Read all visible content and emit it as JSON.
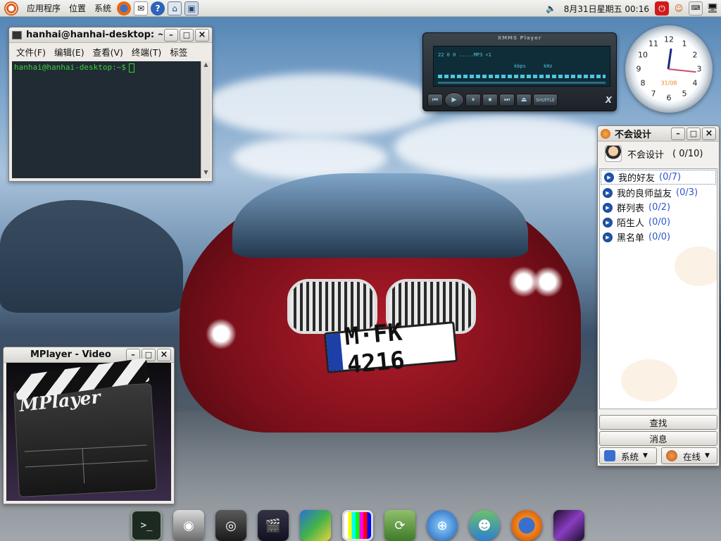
{
  "top_panel": {
    "menus": [
      "应用程序",
      "位置",
      "系统"
    ],
    "launchers": [
      "firefox-icon",
      "mail-icon",
      "help-icon",
      "network-icon",
      "screenshot-icon"
    ],
    "clock": "8月31日星期五 00:16",
    "tray": [
      "volume-icon",
      "power-icon",
      "user-icon",
      "keyboard-icon",
      "monitor-icon"
    ]
  },
  "terminal": {
    "title": "hanhai@hanhai-desktop: ~",
    "menu": [
      "文件(F)",
      "编辑(E)",
      "查看(V)",
      "终端(T)",
      "标签"
    ],
    "prompt": "hanhai@hanhai-desktop:~$"
  },
  "xmms": {
    "title": "XMMS Player",
    "line1": "22  0  0  .....MP3 <1",
    "kbps": "kbps",
    "khz": "kHz",
    "controls": [
      "⏮",
      "▶",
      "⏸",
      "⏹",
      "⏭",
      "⏏"
    ],
    "shuffle": "SHUFFLE",
    "logo": "X"
  },
  "clock_widget": {
    "numbers": [
      "12",
      "1",
      "2",
      "3",
      "4",
      "5",
      "6",
      "7",
      "8",
      "9",
      "10",
      "11"
    ],
    "date": "31/08",
    "time": "00:16"
  },
  "im": {
    "title": "不会设计",
    "user_name": "不会设计",
    "user_count": "( 0/10)",
    "groups": [
      {
        "name": "我的好友",
        "count": "(0/7)"
      },
      {
        "name": "我的良师益友",
        "count": "(0/3)"
      },
      {
        "name": "群列表",
        "count": "(0/2)"
      },
      {
        "name": "陌生人",
        "count": "(0/0)"
      },
      {
        "name": "黑名单",
        "count": "(0/0)"
      }
    ],
    "btn_find": "查找",
    "btn_messages": "消息",
    "system_label": "系统",
    "status_label": "在线"
  },
  "mplayer": {
    "title": "MPlayer - Video",
    "logo_text": "MPlayer"
  },
  "wallpaper": {
    "plate_text": "M·FK 4216"
  },
  "dock": {
    "icons": [
      "terminal-icon",
      "camera-icon",
      "speaker-icon",
      "video-icon",
      "books-icon",
      "tv-test-icon",
      "sync-icon",
      "network-globe-icon",
      "messenger-icon",
      "firefox-icon",
      "wallpaper-icon"
    ]
  },
  "colors": {
    "terminal_bg": "#202b33",
    "terminal_fg": "#3fce3f",
    "count_blue": "#2f55c9"
  }
}
